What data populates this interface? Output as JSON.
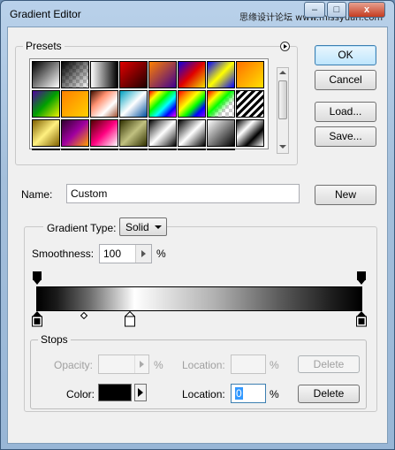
{
  "window": {
    "title": "Gradient Editor",
    "watermark": "思缘设计论坛 www.missyuan.com",
    "controls": {
      "minimize": "–",
      "maximize": "□",
      "close": "x"
    }
  },
  "presets": {
    "label": "Presets",
    "menu_icon": "circle-arrow-right-icon",
    "rows": 4,
    "cols": 8
  },
  "buttons": {
    "ok": "OK",
    "cancel": "Cancel",
    "load": "Load...",
    "save": "Save...",
    "new": "New"
  },
  "name": {
    "label": "Name:",
    "value": "Custom"
  },
  "gradient": {
    "type_label": "Gradient Type:",
    "type_value": "Solid",
    "smoothness_label": "Smoothness:",
    "smoothness_value": "100",
    "smoothness_unit": "%"
  },
  "stops": {
    "label": "Stops",
    "opacity_label": "Opacity:",
    "opacity_value": "",
    "opacity_unit": "%",
    "opacity_location_label": "Location:",
    "opacity_location_value": "",
    "opacity_location_unit": "%",
    "opacity_delete": "Delete",
    "color_label": "Color:",
    "color_value": "#000000",
    "color_location_label": "Location:",
    "color_location_value": "0",
    "color_location_unit": "%",
    "color_delete": "Delete"
  }
}
